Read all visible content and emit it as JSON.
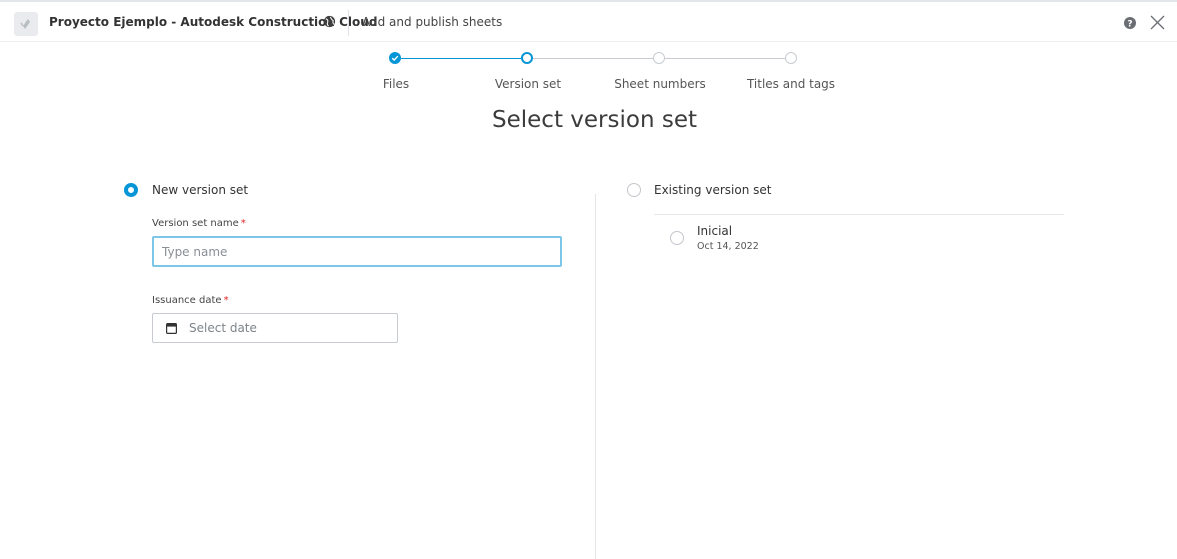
{
  "header": {
    "project_name": "Proyecto Ejemplo - Autodesk Construction Cloud",
    "dialog_title": "Add and publish sheets"
  },
  "stepper": {
    "steps": [
      {
        "label": "Files",
        "state": "completed"
      },
      {
        "label": "Version set",
        "state": "current"
      },
      {
        "label": "Sheet numbers",
        "state": "pending"
      },
      {
        "label": "Titles and tags",
        "state": "pending"
      }
    ]
  },
  "page": {
    "title": "Select version set"
  },
  "new_version_set": {
    "option_label": "New version set",
    "selected": true,
    "name_label": "Version set name",
    "name_placeholder": "Type name",
    "name_value": "",
    "date_label": "Issuance date",
    "required_mark": "*",
    "date_placeholder": "Select date"
  },
  "existing_version_set": {
    "option_label": "Existing version set",
    "selected": false,
    "items": [
      {
        "name": "Inicial",
        "date": "Oct 14, 2022",
        "selected": false
      }
    ]
  },
  "colors": {
    "accent": "#0696d7",
    "input_focus": "#7ec6e8",
    "required": "#dd2222",
    "pending_step": "#c8ccd1"
  },
  "icons": {
    "app_logo": "autodesk-logo-icon",
    "project": "globe-icon",
    "help": "help-icon",
    "close": "close-icon",
    "date": "calendar-icon",
    "step_done": "checkmark-icon"
  }
}
